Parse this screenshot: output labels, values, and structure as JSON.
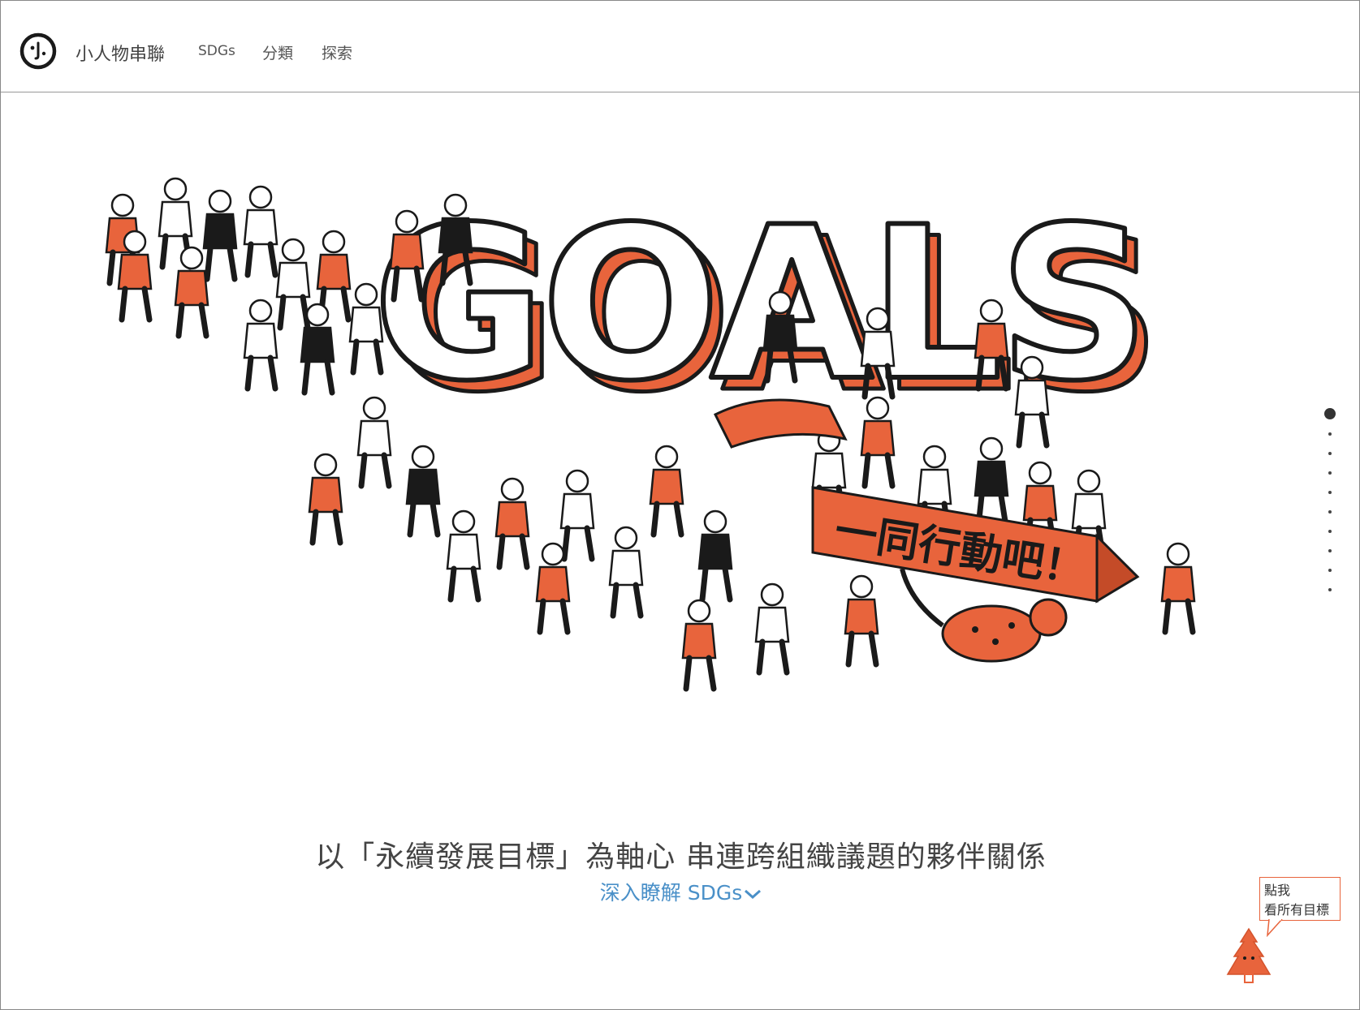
{
  "nav": {
    "logo_icon": "smiley-logo-icon",
    "brand": "小人物串聯",
    "items": [
      "SDGs",
      "分類",
      "探索"
    ]
  },
  "hero": {
    "image": "goals-crowd-illustration",
    "headline": "GOALS",
    "banner": "一同行動吧！",
    "colors": {
      "accent": "#e8643c",
      "ink": "#1a1a1a"
    }
  },
  "tagline": "以「永續發展目標」為軸心 串連跨組織議題的夥伴關係",
  "learn_more": "深入瞭解 SDGs",
  "pager": {
    "count": 10,
    "active": 1
  },
  "mascot": {
    "line1": "點我",
    "line2": "看所有目標",
    "icon": "tree-mascot-icon"
  },
  "colors": {
    "link": "#4a90c8",
    "accent": "#e8643c"
  }
}
